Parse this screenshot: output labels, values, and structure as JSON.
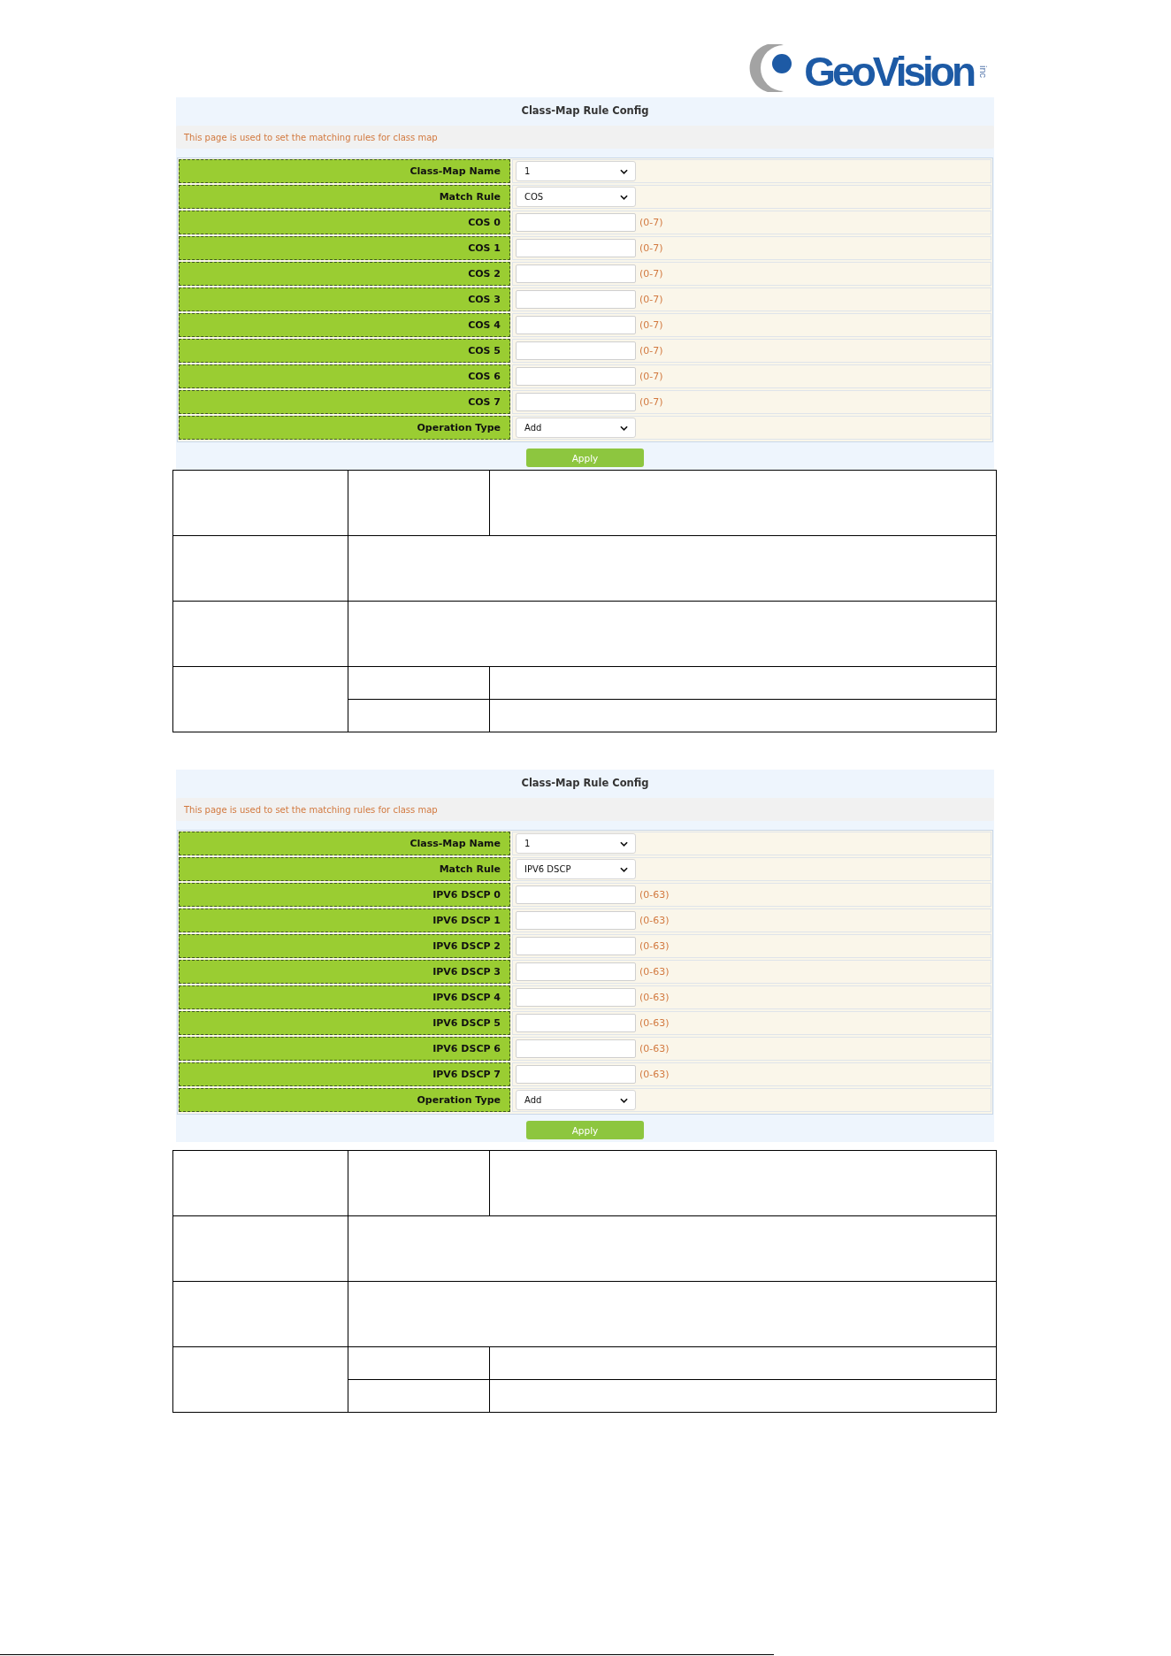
{
  "logo": {
    "name": "GeoVision",
    "suffix": "inc"
  },
  "sections": [
    {
      "panel": {
        "title": "Class-Map Rule Config",
        "description": "This page is used to set the matching rules for class map",
        "fields": [
          {
            "kind": "select",
            "label": "Class-Map Name",
            "value": "1"
          },
          {
            "kind": "select",
            "label": "Match Rule",
            "value": "COS"
          },
          {
            "kind": "input",
            "label": "COS 0",
            "hint": "(0-7)"
          },
          {
            "kind": "input",
            "label": "COS 1",
            "hint": "(0-7)"
          },
          {
            "kind": "input",
            "label": "COS 2",
            "hint": "(0-7)"
          },
          {
            "kind": "input",
            "label": "COS 3",
            "hint": "(0-7)"
          },
          {
            "kind": "input",
            "label": "COS 4",
            "hint": "(0-7)"
          },
          {
            "kind": "input",
            "label": "COS 5",
            "hint": "(0-7)"
          },
          {
            "kind": "input",
            "label": "COS 6",
            "hint": "(0-7)"
          },
          {
            "kind": "input",
            "label": "COS 7",
            "hint": "(0-7)"
          },
          {
            "kind": "select",
            "label": "Operation Type",
            "value": "Add"
          }
        ],
        "button": "Apply"
      },
      "info_table": {
        "rows": [
          {
            "kind": "triple"
          },
          {
            "kind": "wide"
          },
          {
            "kind": "wide"
          },
          {
            "kind": "grouped",
            "sub_rows": [
              {
                "kind": "pair"
              },
              {
                "kind": "pair"
              }
            ]
          }
        ]
      }
    },
    {
      "panel": {
        "title": "Class-Map Rule Config",
        "description": "This page is used to set the matching rules for class map",
        "fields": [
          {
            "kind": "select",
            "label": "Class-Map Name",
            "value": "1"
          },
          {
            "kind": "select",
            "label": "Match Rule",
            "value": "IPV6 DSCP"
          },
          {
            "kind": "input",
            "label": "IPV6 DSCP 0",
            "hint": "(0-63)"
          },
          {
            "kind": "input",
            "label": "IPV6 DSCP 1",
            "hint": "(0-63)"
          },
          {
            "kind": "input",
            "label": "IPV6 DSCP 2",
            "hint": "(0-63)"
          },
          {
            "kind": "input",
            "label": "IPV6 DSCP 3",
            "hint": "(0-63)"
          },
          {
            "kind": "input",
            "label": "IPV6 DSCP 4",
            "hint": "(0-63)"
          },
          {
            "kind": "input",
            "label": "IPV6 DSCP 5",
            "hint": "(0-63)"
          },
          {
            "kind": "input",
            "label": "IPV6 DSCP 6",
            "hint": "(0-63)"
          },
          {
            "kind": "input",
            "label": "IPV6 DSCP 7",
            "hint": "(0-63)"
          },
          {
            "kind": "select",
            "label": "Operation Type",
            "value": "Add"
          }
        ],
        "button": "Apply"
      },
      "info_table": {
        "rows": [
          {
            "kind": "triple"
          },
          {
            "kind": "wide"
          },
          {
            "kind": "wide"
          },
          {
            "kind": "grouped",
            "sub_rows": [
              {
                "kind": "pair"
              },
              {
                "kind": "pair"
              }
            ]
          }
        ]
      }
    }
  ]
}
